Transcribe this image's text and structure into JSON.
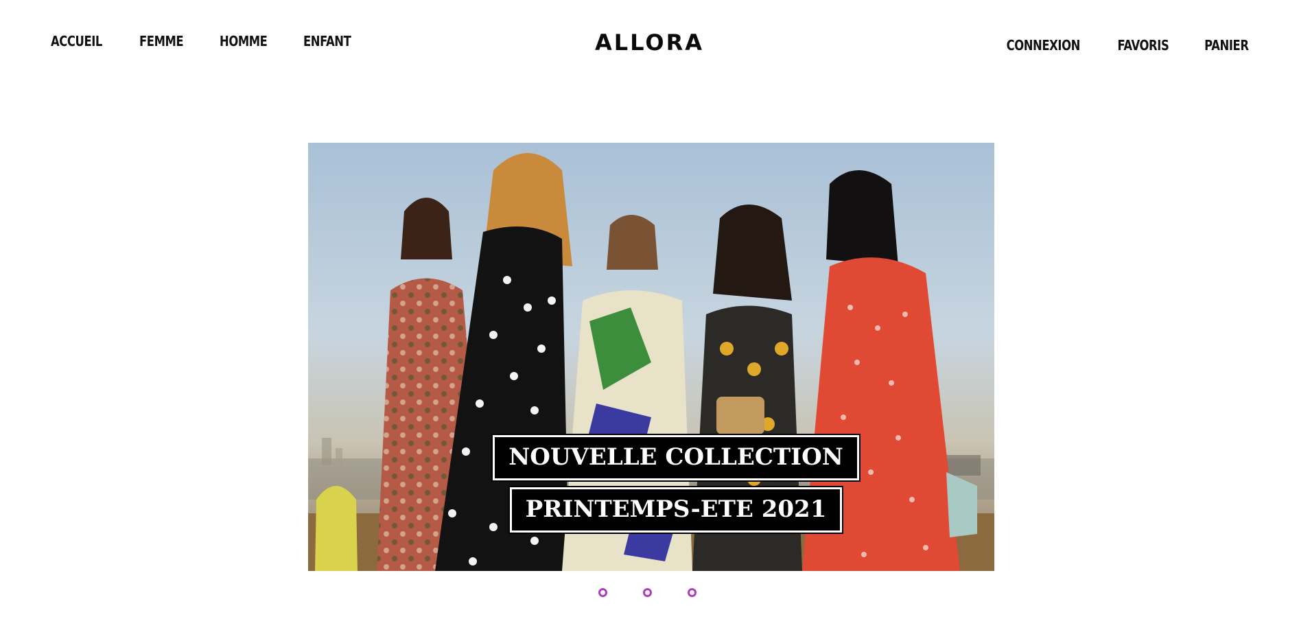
{
  "header": {
    "logo": "ALLORA",
    "nav_left": [
      "ACCUEIL",
      "FEMME",
      "HOMME",
      "ENFANT"
    ],
    "nav_right": [
      "CONNEXION",
      "FAVORIS",
      "PANIER"
    ]
  },
  "hero": {
    "caption_line1": "NOUVELLE COLLECTION",
    "caption_line2": "PRINTEMPS-ETE 2021",
    "slide_count": 3
  },
  "colors": {
    "dot_accent": "#b03bbf",
    "caption_bg": "#000000",
    "caption_text": "#ffffff"
  }
}
